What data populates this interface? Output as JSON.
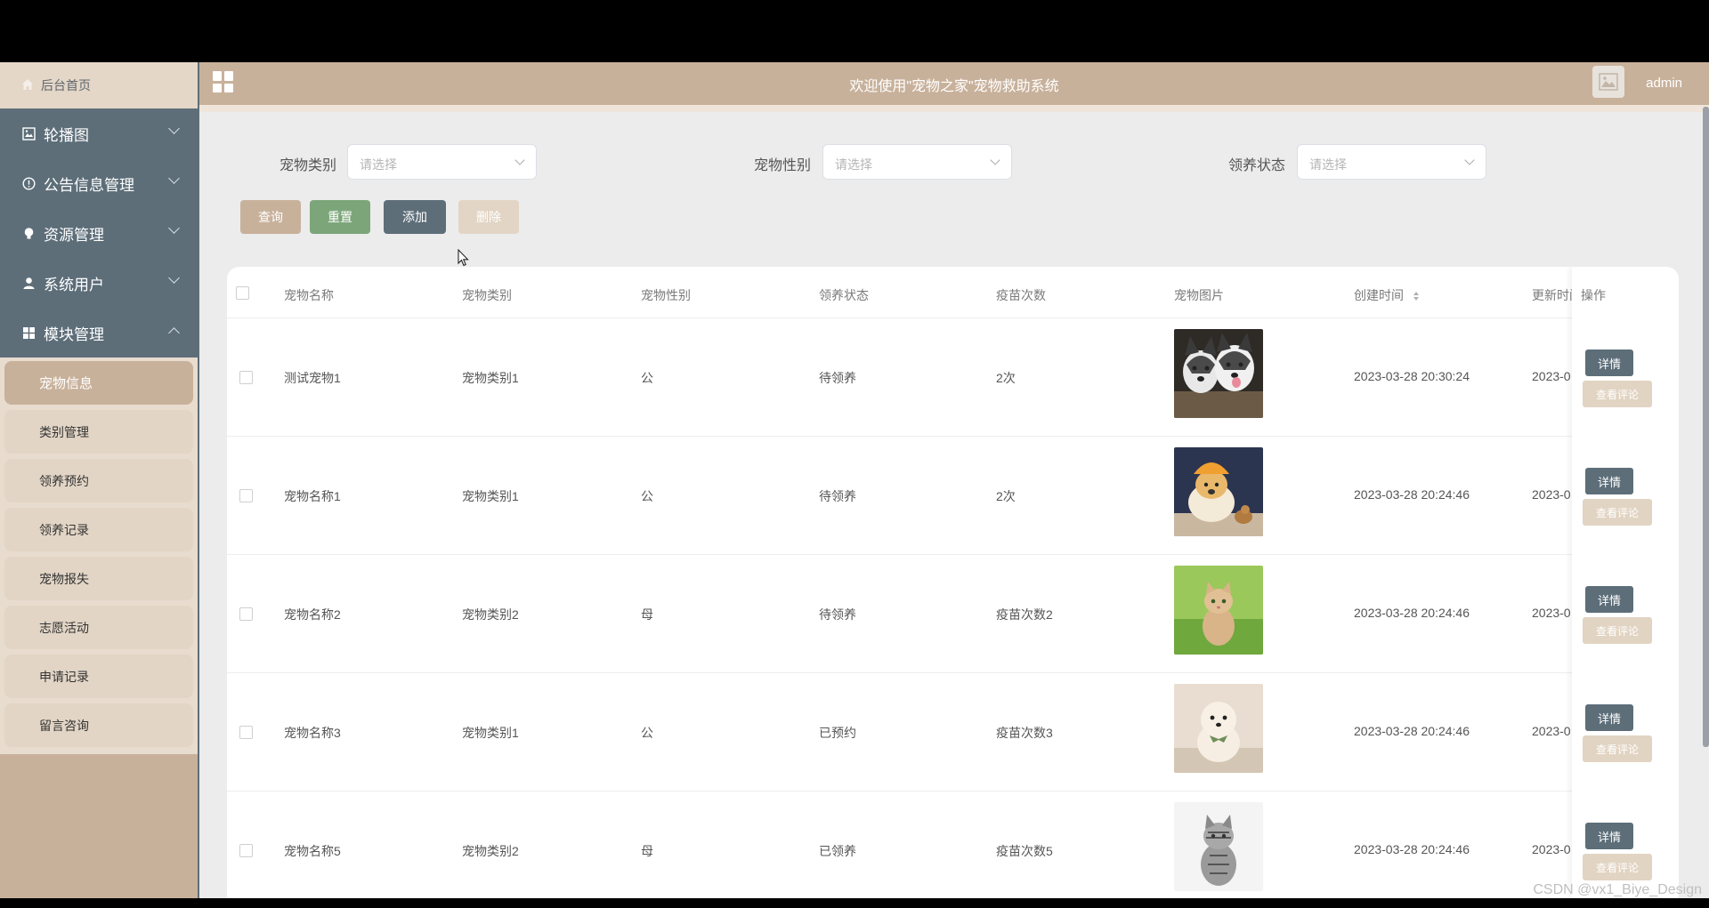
{
  "sidebar": {
    "home": "后台首页",
    "groups": [
      {
        "label": "轮播图",
        "icon": "image-icon"
      },
      {
        "label": "公告信息管理",
        "icon": "info-icon"
      },
      {
        "label": "资源管理",
        "icon": "bulb-icon"
      },
      {
        "label": "系统用户",
        "icon": "user-icon"
      },
      {
        "label": "模块管理",
        "icon": "grid-icon",
        "expanded": true
      }
    ],
    "subitems": [
      "宠物信息",
      "类别管理",
      "领养预约",
      "领养记录",
      "宠物报失",
      "志愿活动",
      "申请记录",
      "留言咨询"
    ],
    "active_subitem": "宠物信息"
  },
  "header": {
    "title": "欢迎使用\"宠物之家\"宠物救助系统",
    "username": "admin"
  },
  "filters": {
    "category_label": "宠物类别",
    "gender_label": "宠物性别",
    "status_label": "领养状态",
    "placeholder": "请选择"
  },
  "buttons": {
    "query": "查询",
    "reset": "重置",
    "add": "添加",
    "delete": "删除"
  },
  "colors": {
    "primary_brown": "#c8b19b",
    "slate": "#5d6e79",
    "reset_green": "#7ca67a"
  },
  "table": {
    "headers": [
      "宠物名称",
      "宠物类别",
      "宠物性别",
      "领养状态",
      "疫苗次数",
      "宠物图片",
      "创建时间",
      "更新时间",
      "操作"
    ],
    "rows": [
      {
        "name": "测试宠物1",
        "category": "宠物类别1",
        "gender": "公",
        "status": "待领养",
        "vaccine": "2次",
        "image": "two-huskies-photo",
        "created": "2023-03-28 20:30:24",
        "updated": "2023-0"
      },
      {
        "name": "宠物名称1",
        "category": "宠物类别1",
        "gender": "公",
        "status": "待领养",
        "vaccine": "2次",
        "image": "puppy-with-hat-photo",
        "created": "2023-03-28 20:24:46",
        "updated": "2023-0"
      },
      {
        "name": "宠物名称2",
        "category": "宠物类别2",
        "gender": "母",
        "status": "待领养",
        "vaccine": "疫苗次数2",
        "image": "kitten-in-grass-photo",
        "created": "2023-03-28 20:24:46",
        "updated": "2023-0"
      },
      {
        "name": "宠物名称3",
        "category": "宠物类别1",
        "gender": "公",
        "status": "已预约",
        "vaccine": "疫苗次数3",
        "image": "pomeranian-photo",
        "created": "2023-03-28 20:24:46",
        "updated": "2023-0"
      },
      {
        "name": "宠物名称5",
        "category": "宠物类别2",
        "gender": "母",
        "status": "已领养",
        "vaccine": "疫苗次数5",
        "image": "tabby-cat-photo",
        "created": "2023-03-28 20:24:46",
        "updated": "2023-0"
      }
    ],
    "detail_label": "详情",
    "comment_label": "查看评论"
  },
  "watermark": "CSDN @vx1_Biye_Design"
}
